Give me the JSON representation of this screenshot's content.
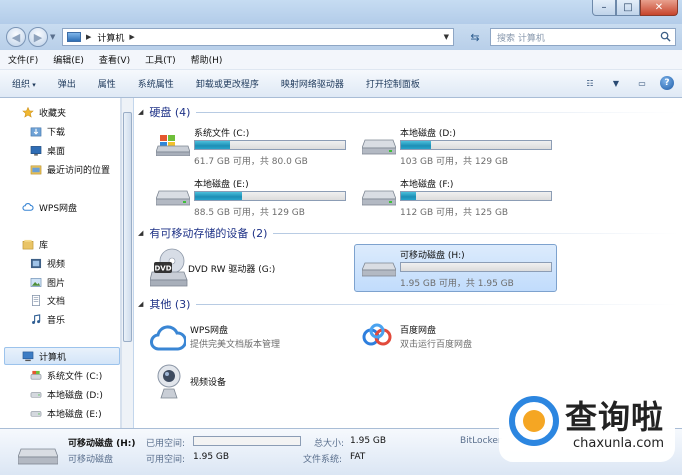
{
  "window": {
    "min": "–",
    "max": "□",
    "close": "✕"
  },
  "address": {
    "path": "计算机",
    "search_placeholder": "搜索 计算机"
  },
  "menu": [
    "文件(F)",
    "编辑(E)",
    "查看(V)",
    "工具(T)",
    "帮助(H)"
  ],
  "toolbar": [
    "组织",
    "弹出",
    "属性",
    "系统属性",
    "卸载或更改程序",
    "映射网络驱动器",
    "打开控制面板"
  ],
  "nav": {
    "favorites": "收藏夹",
    "downloads": "下载",
    "desktop": "桌面",
    "recent": "最近访问的位置",
    "wps": "WPS网盘",
    "libraries": "库",
    "videos": "视频",
    "pictures": "图片",
    "documents": "文档",
    "music": "音乐",
    "computer": "计算机",
    "drive_c": "系统文件 (C:)",
    "drive_d": "本地磁盘 (D:)",
    "drive_e": "本地磁盘 (E:)"
  },
  "groups": {
    "hdd": "硬盘 (4)",
    "removable": "有可移动存储的设备 (2)",
    "other": "其他 (3)"
  },
  "drives": {
    "c": {
      "name": "系统文件 (C:)",
      "info": "61.7 GB 可用，共 80.0 GB",
      "used_fraction": 0.23
    },
    "d": {
      "name": "本地磁盘 (D:)",
      "info": "103 GB 可用，共 129 GB",
      "used_fraction": 0.2
    },
    "e": {
      "name": "本地磁盘 (E:)",
      "info": "88.5 GB 可用，共 129 GB",
      "used_fraction": 0.31
    },
    "f": {
      "name": "本地磁盘 (F:)",
      "info": "112 GB 可用，共 125 GB",
      "used_fraction": 0.1
    },
    "h": {
      "name": "可移动磁盘 (H:)",
      "info": "1.95 GB 可用，共 1.95 GB",
      "used_fraction": 0.0
    }
  },
  "dvd": {
    "name": "DVD RW 驱动器 (G:)",
    "label": "DVD"
  },
  "others": {
    "wps_name": "WPS网盘",
    "wps_desc": "提供完美文档版本管理",
    "baidu_name": "百度网盘",
    "baidu_desc": "双击运行百度网盘",
    "video_name": "视频设备"
  },
  "details": {
    "name": "可移动磁盘 (H:)",
    "type": "可移动磁盘",
    "used_label": "已用空间:",
    "free_label": "可用空间:",
    "free_value": "1.95 GB",
    "total_label": "总大小:",
    "total_value": "1.95 GB",
    "fs_label": "文件系统:",
    "fs_value": "FAT",
    "bitlocker": "BitLocker"
  },
  "watermark": {
    "cn": "查询啦",
    "en": "chaxunla.com"
  }
}
